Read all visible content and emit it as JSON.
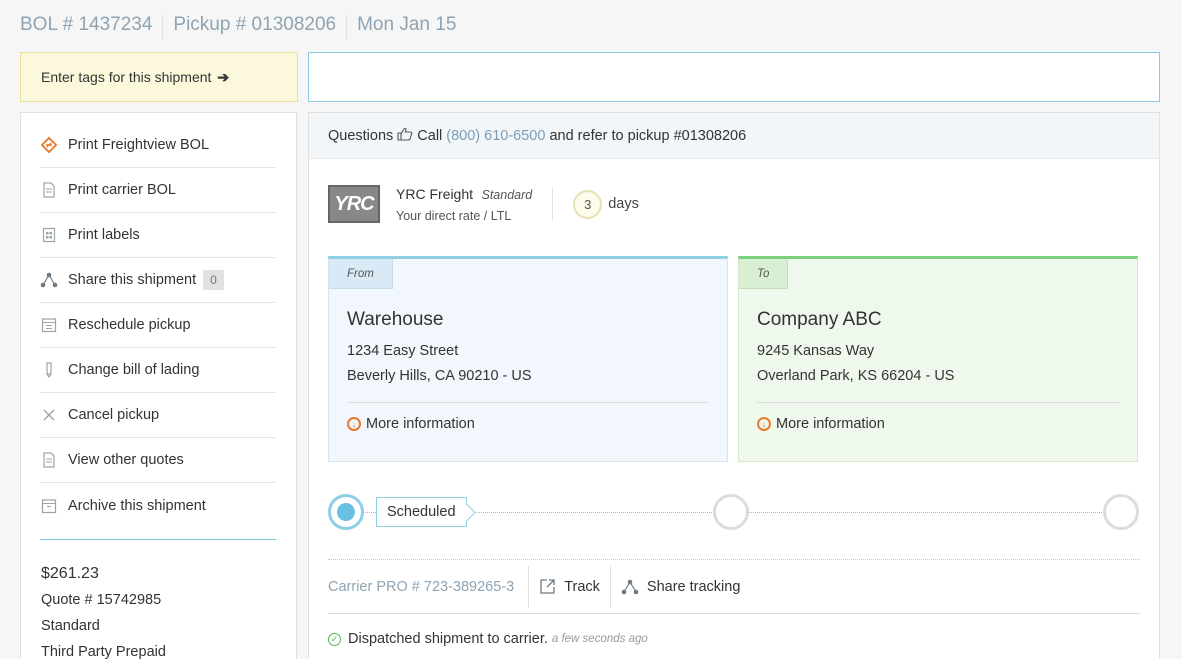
{
  "header": {
    "bol": "BOL # 1437234",
    "pickup": "Pickup # 01308206",
    "date": "Mon Jan 15"
  },
  "tags": {
    "label": "Enter tags for this shipment",
    "arrow": "➔",
    "input_value": ""
  },
  "sidebar": {
    "items": [
      {
        "label": "Print Freightview BOL",
        "icon": "freightview-logo-icon"
      },
      {
        "label": "Print carrier BOL",
        "icon": "document-icon"
      },
      {
        "label": "Print labels",
        "icon": "labels-icon"
      },
      {
        "label": "Share this shipment",
        "icon": "share-icon",
        "badge": "0"
      },
      {
        "label": "Reschedule pickup",
        "icon": "calendar-icon"
      },
      {
        "label": "Change bill of lading",
        "icon": "pencil-icon"
      },
      {
        "label": "Cancel pickup",
        "icon": "close-icon"
      },
      {
        "label": "View other quotes",
        "icon": "document-icon"
      },
      {
        "label": "Archive this shipment",
        "icon": "archive-icon"
      }
    ],
    "price": "$261.23",
    "quote": "Quote # 15742985",
    "service": "Standard",
    "payment": "Third Party Prepaid"
  },
  "questions": {
    "prefix": "Questions",
    "call": "Call",
    "phone": "(800) 610-6500",
    "suffix": "and refer to pickup #01308206"
  },
  "carrier": {
    "logo_text": "YRC",
    "name": "YRC Freight",
    "service": "Standard",
    "rate": "Your direct rate / LTL",
    "days": "3",
    "days_label": "days"
  },
  "from": {
    "tag": "From",
    "company": "Warehouse",
    "street": "1234 Easy Street",
    "city": "Beverly Hills, CA 90210 - US",
    "more": "More information"
  },
  "to": {
    "tag": "To",
    "company": "Company ABC",
    "street": "9245 Kansas Way",
    "city": "Overland Park, KS 66204 - US",
    "more": "More information"
  },
  "timeline": {
    "current_status": "Scheduled"
  },
  "tracking": {
    "pro": "Carrier PRO # 723-389265-3",
    "track_label": "Track",
    "share_label": "Share tracking"
  },
  "status": {
    "message": "Dispatched shipment to carrier.",
    "ago": "a few seconds ago"
  },
  "colors": {
    "accent": "#8fcfe4",
    "orange": "#e8792a",
    "green": "#4cb848"
  }
}
